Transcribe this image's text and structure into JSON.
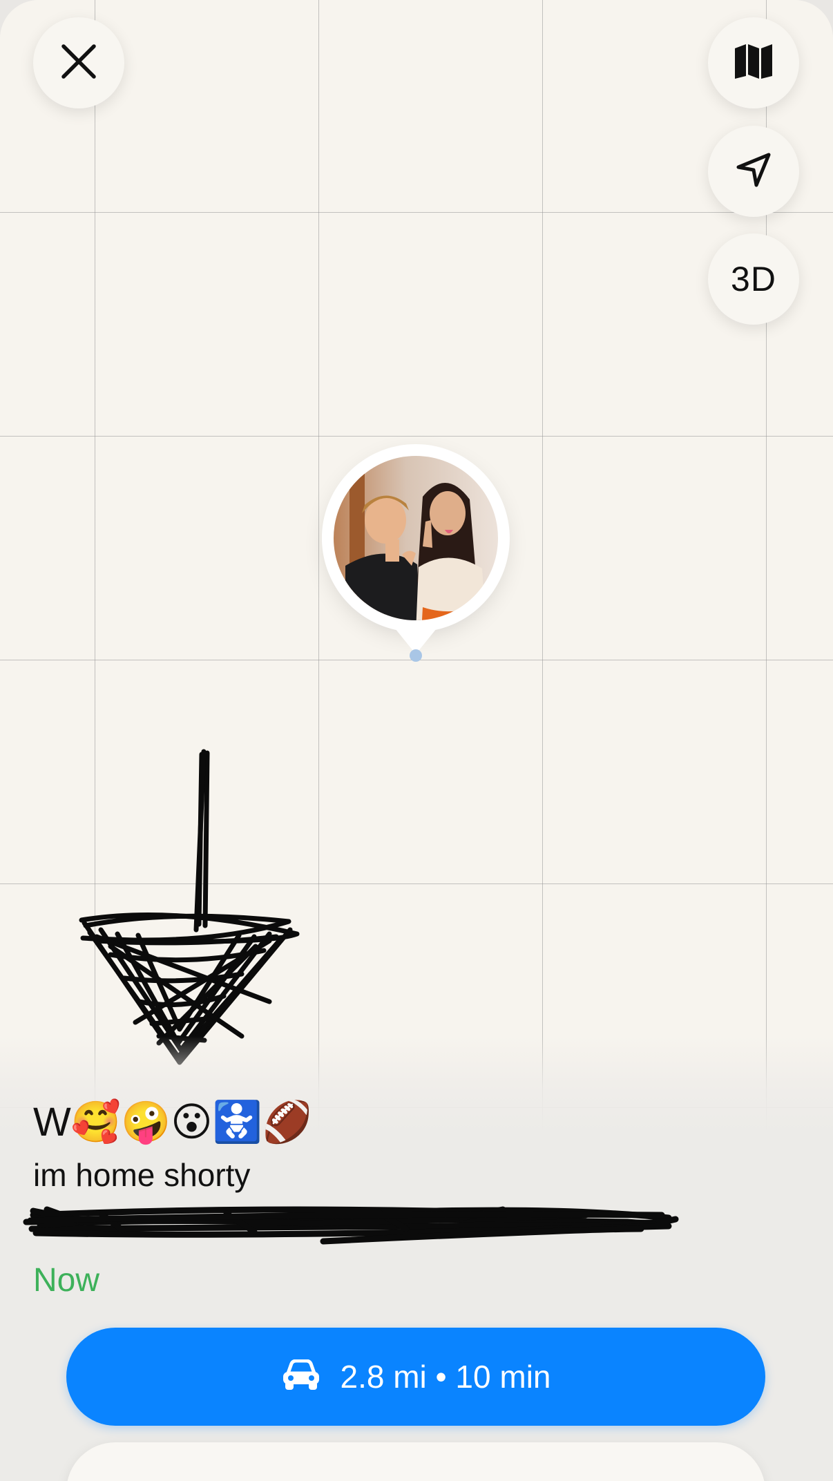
{
  "map": {
    "buttons": {
      "close_icon": "close-icon",
      "map_icon": "map-icon",
      "locate_icon": "location-arrow-icon",
      "three_d_label": "3D"
    },
    "pin": {
      "avatar": "friend-photo"
    }
  },
  "place": {
    "title": "W",
    "emojis": [
      "🥰",
      "🤪",
      "😮",
      "🚼",
      "🏈"
    ],
    "message": "im home shorty",
    "address": "",
    "status": "Now"
  },
  "directions": {
    "icon": "car-icon",
    "label": "2.8 mi • 10 min"
  },
  "colors": {
    "accent": "#0a84ff",
    "status": "#3db15a",
    "map_background": "#f7f4ee"
  }
}
